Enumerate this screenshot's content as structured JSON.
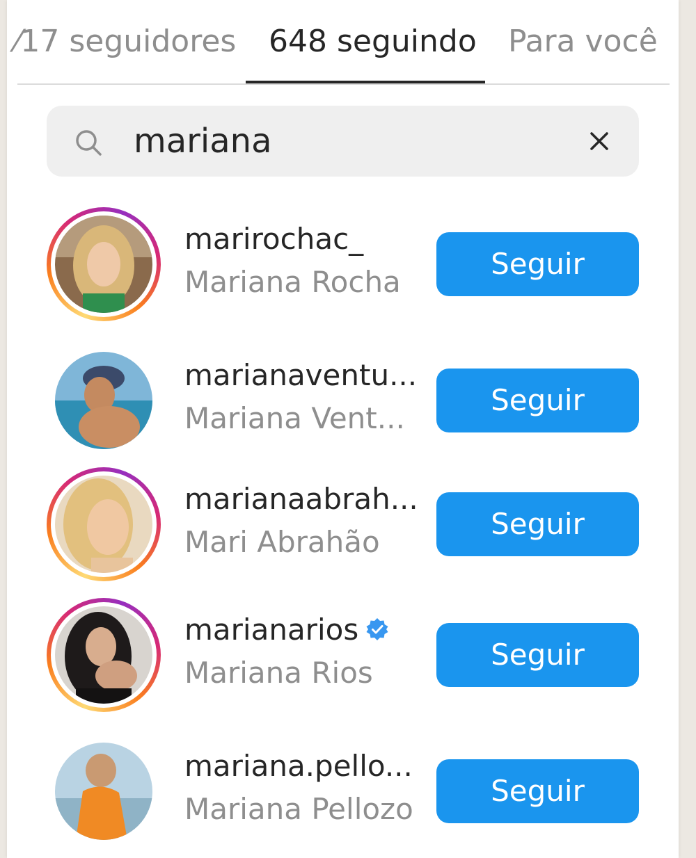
{
  "tabs": [
    {
      "label": "⁄17 seguidores",
      "active": false
    },
    {
      "label": "648 seguindo",
      "active": true
    },
    {
      "label": "Para você",
      "active": false
    }
  ],
  "search": {
    "value": "mariana",
    "icon": "search-icon",
    "clear_icon": "close-icon"
  },
  "colors": {
    "accent": "#1a95ee",
    "primary_text": "#262626",
    "secondary_text": "#8e8e8e",
    "search_bg": "#efefef",
    "story_ring": [
      "#feda75",
      "#fa7e1e",
      "#d62976",
      "#962fbf"
    ],
    "verified": "#3897f0"
  },
  "users": [
    {
      "username": "marirochac_",
      "full_name": "Mariana Rocha",
      "button": "Seguir",
      "story_ring": true,
      "verified": false
    },
    {
      "username": "marianaventu...",
      "full_name": "Mariana Vent...",
      "button": "Seguir",
      "story_ring": false,
      "verified": false
    },
    {
      "username": "marianaabrah...",
      "full_name": "Mari Abrahão",
      "button": "Seguir",
      "story_ring": true,
      "verified": false
    },
    {
      "username": "marianarios",
      "full_name": "Mariana Rios",
      "button": "Seguir",
      "story_ring": true,
      "verified": true
    },
    {
      "username": "mariana.pello...",
      "full_name": "Mariana Pellozo",
      "button": "Seguir",
      "story_ring": false,
      "verified": false
    }
  ]
}
